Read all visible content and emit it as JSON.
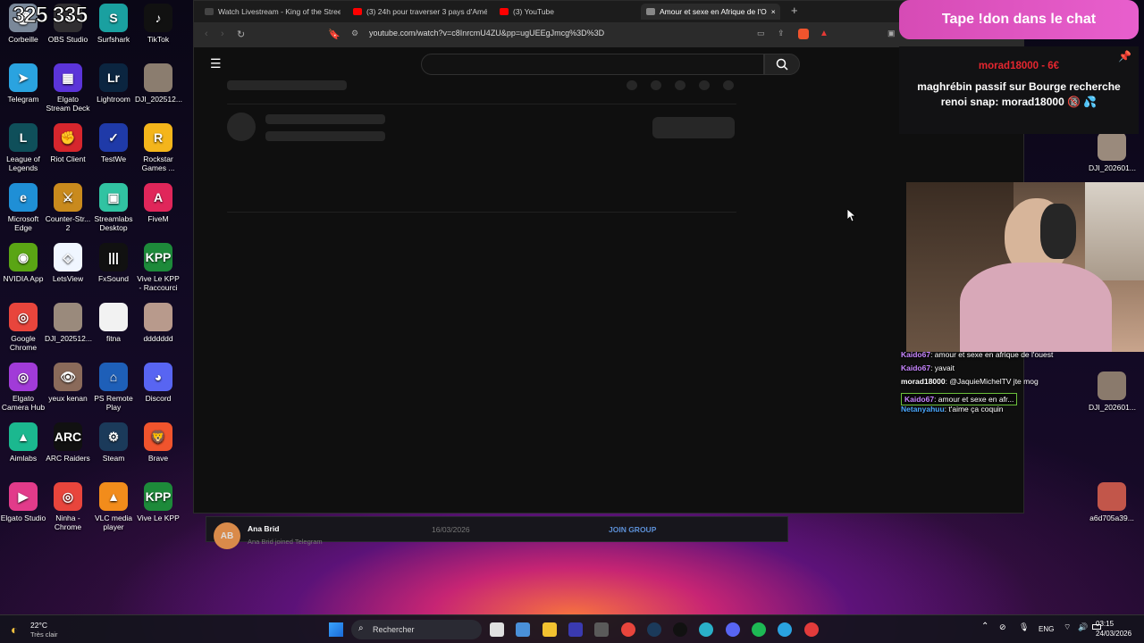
{
  "desktop": {
    "icons": [
      {
        "label": "Corbeille",
        "color": "#7a8899",
        "glyph": "🗑"
      },
      {
        "label": "OBS Studio",
        "color": "#302e31",
        "glyph": "●"
      },
      {
        "label": "Surfshark",
        "color": "#1aa0a0",
        "glyph": "S"
      },
      {
        "label": "TikTok",
        "color": "#111111",
        "glyph": "♪"
      },
      {
        "label": "Telegram",
        "color": "#2aa3e0",
        "glyph": "➤"
      },
      {
        "label": "Elgato Stream Deck",
        "color": "#5b34d9",
        "glyph": "▦"
      },
      {
        "label": "Lightroom",
        "color": "#0b2540",
        "glyph": "Lr"
      },
      {
        "label": "DJI_202512...",
        "color": "#8b7d6f",
        "glyph": ""
      },
      {
        "label": "League of Legends",
        "color": "#0f4f5a",
        "glyph": "L"
      },
      {
        "label": "Riot Client",
        "color": "#d6262d",
        "glyph": "✊"
      },
      {
        "label": "TestWe",
        "color": "#1f3aa8",
        "glyph": "✓"
      },
      {
        "label": "Rockstar Games ...",
        "color": "#f4b51b",
        "glyph": "R"
      },
      {
        "label": "Microsoft Edge",
        "color": "#1f8fd6",
        "glyph": "e"
      },
      {
        "label": "Counter-Str... 2",
        "color": "#c98a1d",
        "glyph": "⚔"
      },
      {
        "label": "Streamlabs Desktop",
        "color": "#31c3a2",
        "glyph": "▣"
      },
      {
        "label": "FiveM",
        "color": "#e0265a",
        "glyph": "A"
      },
      {
        "label": "NVIDIA App",
        "color": "#5aa514",
        "glyph": "◉"
      },
      {
        "label": "LetsView",
        "color": "#f0f6ff",
        "glyph": "◇"
      },
      {
        "label": "FxSound",
        "color": "#111111",
        "glyph": "|||"
      },
      {
        "label": "Vive Le KPP - Raccourci",
        "color": "#1d8a3a",
        "glyph": "KPP"
      },
      {
        "label": "Google Chrome",
        "color": "#e8453c",
        "glyph": "◎"
      },
      {
        "label": "DJI_202512...",
        "color": "#9a8a7c",
        "glyph": ""
      },
      {
        "label": "fitna",
        "color": "#f2f2f2",
        "glyph": ""
      },
      {
        "label": "ddddddd",
        "color": "#b89a8c",
        "glyph": ""
      },
      {
        "label": "Elgato Camera Hub",
        "color": "#a13bd8",
        "glyph": "◎"
      },
      {
        "label": "yeux kenan",
        "color": "#8a6a5a",
        "glyph": "👁"
      },
      {
        "label": "PS Remote Play",
        "color": "#1e5fb8",
        "glyph": "⌂"
      },
      {
        "label": "Discord",
        "color": "#5865f2",
        "glyph": "◕"
      },
      {
        "label": "Aimlabs",
        "color": "#1bb88f",
        "glyph": "▲"
      },
      {
        "label": "ARC Raiders",
        "color": "#111111",
        "glyph": "ARC"
      },
      {
        "label": "Steam",
        "color": "#1b3a5a",
        "glyph": "⚙"
      },
      {
        "label": "Brave",
        "color": "#f0542d",
        "glyph": "🦁"
      },
      {
        "label": "Elgato Studio",
        "color": "#e23b8a",
        "glyph": "▶"
      },
      {
        "label": "Ninha - Chrome",
        "color": "#e8453c",
        "glyph": "◎"
      },
      {
        "label": "VLC media player",
        "color": "#f28c1b",
        "glyph": "▲"
      },
      {
        "label": "Vive Le KPP",
        "color": "#1d8a3a",
        "glyph": "KPP"
      }
    ],
    "right_icons": [
      {
        "label": "DJI_202601...",
        "color": "#9a8a7c"
      },
      {
        "label": "DJI_202601...",
        "color": "#8a7a6c"
      },
      {
        "label": "a6d705a39...",
        "color": "#c2564a"
      }
    ],
    "counter_text": "325 335"
  },
  "browser": {
    "tabs": [
      {
        "label": "Watch Livestream - King of the Stree",
        "color": "#444444"
      },
      {
        "label": "(3) 24h pour traverser 3 pays d'Amér",
        "color": "#ff0000"
      },
      {
        "label": "(3) YouTube",
        "color": "#ff0000"
      },
      {
        "label": "Amour et sexe en Afrique de l'O",
        "color": "#888888"
      }
    ],
    "new_tab": "+",
    "close_tab": "×",
    "url": "youtube.com/watch?v=c8InrcmU4ZU&pp=ugUEEgJmcg%3D%3D"
  },
  "notification": {
    "avatar": "AB",
    "name": "Ana Brid",
    "subtext": "Ana Brid joined Telegram",
    "date": "16/03/2026",
    "action": "JOIN GROUP"
  },
  "overlay": {
    "banner": "Tape !don dans le chat",
    "don_user": "morad18000 - 6€",
    "don_message": "maghrébin passif sur Bourge recherche renoi snap: morad18000 🔞 💦",
    "chat": [
      {
        "user": "Kaido67",
        "text": ": amour et sexe en afrique de l'ouest",
        "color": "#c785ff"
      },
      {
        "user": "Kaido67",
        "text": ": yavait",
        "color": "#c785ff"
      },
      {
        "user": "morad18000",
        "text": ": @JaquieMichelTV jte mog",
        "color": "#ffffff"
      },
      {
        "user": "Kaido67",
        "text": ": amour et sexe en afr...",
        "color": "#c785ff"
      },
      {
        "user": "Netanyahuu",
        "text": ": t'aime ça coquin",
        "color": "#4aa8ff"
      }
    ]
  },
  "taskbar": {
    "weather_temp": "22°C",
    "weather_desc": "Très clair",
    "search_label": "Rechercher",
    "lang": "ENG",
    "time": "03:15",
    "date": "24/03/2026"
  }
}
